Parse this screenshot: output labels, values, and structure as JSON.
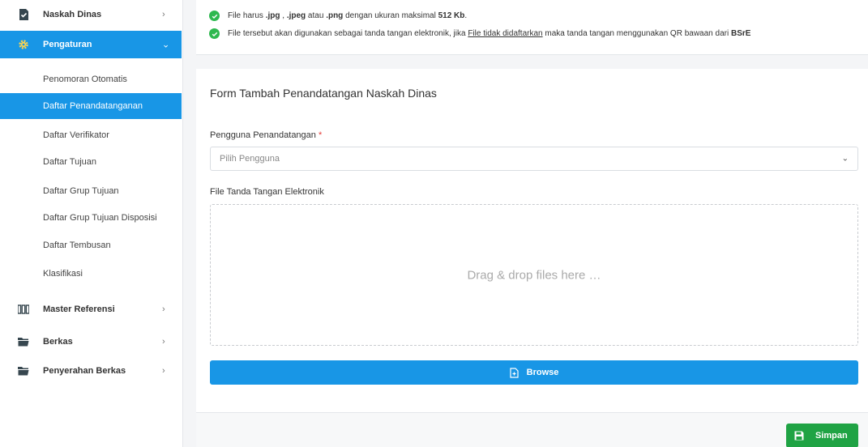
{
  "sidebar": {
    "naskah_dinas": {
      "label": "Naskah Dinas",
      "icon": "document-check-icon"
    },
    "pengaturan": {
      "label": "Pengaturan",
      "icon": "gear-icon"
    },
    "submenu": [
      {
        "label": "Penomoran Otomatis"
      },
      {
        "label": "Daftar Penandatanganan"
      },
      {
        "label": "Daftar Verifikator"
      },
      {
        "label": "Daftar Tujuan"
      },
      {
        "label": "Daftar Grup Tujuan"
      },
      {
        "label": "Daftar Grup Tujuan Disposisi"
      },
      {
        "label": "Daftar Tembusan"
      },
      {
        "label": "Klasifikasi"
      }
    ],
    "master_referensi": {
      "label": "Master Referensi",
      "icon": "grid-icon"
    },
    "berkas": {
      "label": "Berkas",
      "icon": "folder-icon"
    },
    "penyerahan_berkas": {
      "label": "Penyerahan Berkas",
      "icon": "folder-icon"
    }
  },
  "info": {
    "line1": {
      "p1": "File harus ",
      "jpg": ".jpg",
      "p2": " , ",
      "jpeg": ".jpeg",
      "p3": " atau ",
      "png": ".png",
      "p4": " dengan ukuran maksimal ",
      "size": "512 Kb",
      "p5": "."
    },
    "line2": {
      "p1": "File tersebut akan digunakan sebagai tanda tangan elektronik, jika ",
      "link": "File tidak didaftarkan",
      "p2": " maka tanda tangan menggunakan QR bawaan dari ",
      "bsre": "BSrE"
    }
  },
  "form": {
    "title": "Form Tambah Penandatangan Naskah Dinas",
    "user_label": "Pengguna Penandatangan",
    "required_mark": "*",
    "user_placeholder": "Pilih Pengguna",
    "file_label": "File Tanda Tangan Elektronik",
    "dropzone_text": "Drag & drop files here …",
    "browse_label": "Browse",
    "save_label": "Simpan"
  },
  "colors": {
    "primary": "#1896e6",
    "success": "#1fa344",
    "check": "#2eb84f"
  }
}
